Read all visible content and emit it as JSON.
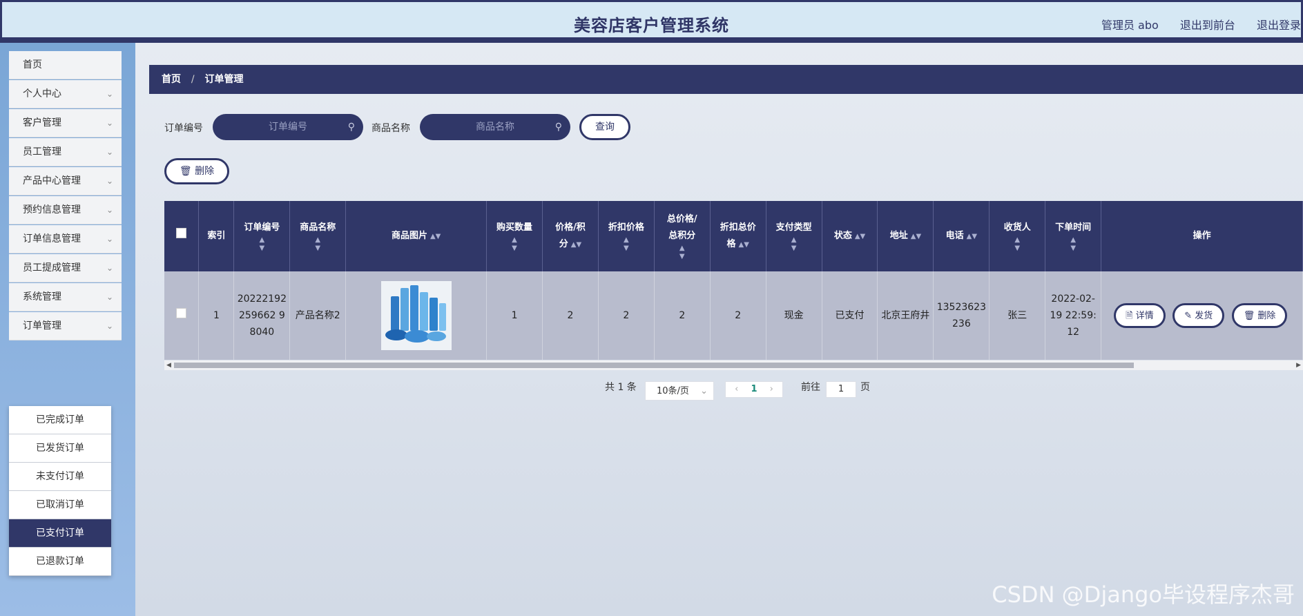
{
  "header": {
    "title": "美容店客户管理系统",
    "admin": "管理员 abo",
    "to_front": "退出到前台",
    "logout": "退出登录"
  },
  "sidebar": {
    "items": [
      {
        "label": "首页"
      },
      {
        "label": "个人中心"
      },
      {
        "label": "客户管理"
      },
      {
        "label": "员工管理"
      },
      {
        "label": "产品中心管理"
      },
      {
        "label": "预约信息管理"
      },
      {
        "label": "订单信息管理"
      },
      {
        "label": "员工提成管理"
      },
      {
        "label": "系统管理"
      },
      {
        "label": "订单管理"
      }
    ],
    "submenu": [
      {
        "label": "已完成订单"
      },
      {
        "label": "已发货订单"
      },
      {
        "label": "未支付订单"
      },
      {
        "label": "已取消订单"
      },
      {
        "label": "已支付订单",
        "active": true
      },
      {
        "label": "已退款订单"
      }
    ]
  },
  "breadcrumb": {
    "home": "首页",
    "sep": "/",
    "current": "订单管理"
  },
  "search": {
    "order_no_label": "订单编号",
    "order_no_placeholder": "订单编号",
    "product_label": "商品名称",
    "product_placeholder": "商品名称",
    "query_button": "查询"
  },
  "toolbar": {
    "delete_label": "删除"
  },
  "table": {
    "headers": {
      "index": "索引",
      "order_no": "订单编号",
      "product_name": "商品名称",
      "product_image": "商品图片",
      "quantity": "购买数量",
      "price_line1": "价格/积",
      "price_line2": "分",
      "discount_price": "折扣价格",
      "total_line1": "总价格/",
      "total_line2": "总积分",
      "discount_total_line1": "折扣总价",
      "discount_total_line2": "格",
      "pay_type": "支付类型",
      "status": "状态",
      "address": "地址",
      "phone": "电话",
      "receiver": "收货人",
      "order_time": "下单时间",
      "actions": "操作"
    },
    "rows": [
      {
        "index": "1",
        "order_no": "20222192259662 98040",
        "product_name": "产品名称2",
        "quantity": "1",
        "price": "2",
        "discount_price": "2",
        "total": "2",
        "discount_total": "2",
        "pay_type": "现金",
        "status": "已支付",
        "address": "北京王府井",
        "phone": "13523623236",
        "receiver": "张三",
        "order_time": "2022-02-19 22:59:12",
        "detail_label": "详情",
        "ship_label": "发货",
        "delete_label": "删除"
      }
    ]
  },
  "pagination": {
    "total": "共 1 条",
    "page_size": "10条/页",
    "current_page": "1",
    "goto_label": "前往",
    "goto_value": "1",
    "page_suffix": "页"
  },
  "watermark": "CSDN @Django毕设程序杰哥",
  "colors": {
    "primary": "#303768",
    "row_bg": "#b8bccd",
    "sidebar": "#8fb4e0"
  }
}
